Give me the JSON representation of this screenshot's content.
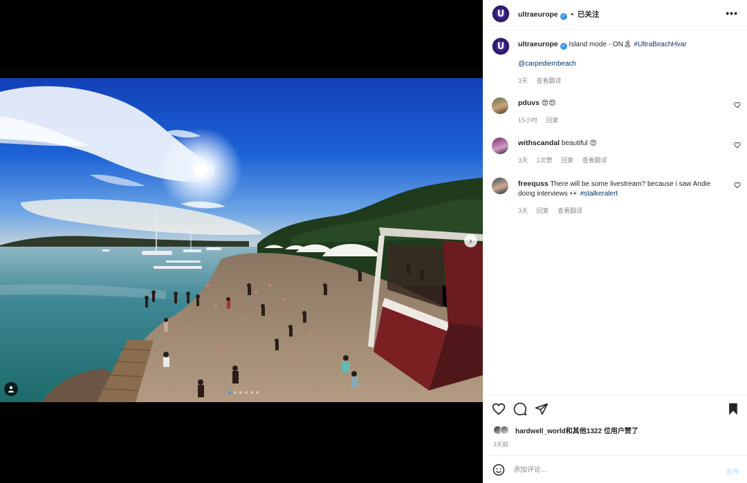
{
  "media": {
    "carousel_total": 6,
    "carousel_active": 1,
    "next_icon": "chevron-right-icon",
    "tag_icon": "person-tag-icon"
  },
  "header": {
    "username": "ultraeurope",
    "verified_icon": "verified-badge-icon",
    "separator": "•",
    "follow_status": "已关注",
    "more_icon": "more-dots-icon",
    "avatar_letter": "U"
  },
  "caption": {
    "username": "ultraeurope",
    "text": "Island mode - ON🏝",
    "hashtag": "#UltraBeachHvar",
    "mention": "@carpediembeach",
    "time": "3天",
    "translate": "查看翻译"
  },
  "comments": [
    {
      "username": "pduvs",
      "text": "😍😍",
      "time": "15小时",
      "reply": "回复",
      "likes": "",
      "translate": ""
    },
    {
      "username": "withscandal",
      "text": "beautiful 😍",
      "time": "3天",
      "likes": "1次赞",
      "reply": "回复",
      "translate": "查看翻译"
    },
    {
      "username": "freequss",
      "text": "There will be some livestream? because i saw Andie doing interviews 👀 ",
      "hashtag": "#stalkeralert",
      "time": "3天",
      "reply": "回复",
      "likes": "",
      "translate": "查看翻译"
    }
  ],
  "actions": {
    "like_icon": "heart-icon",
    "comment_icon": "comment-icon",
    "share_icon": "share-icon",
    "save_icon": "bookmark-icon",
    "likes_text": "hardwell_world和其他1322 位用户赞了",
    "posted_time": "3天前"
  },
  "add_comment": {
    "emoji_icon": "emoji-icon",
    "placeholder": "添加评论...",
    "post_label": "发布"
  },
  "colors": {
    "link": "#00376b",
    "verified": "#3897f0",
    "post_disabled": "#b3dbff",
    "secondary_text": "#8e8e8e"
  }
}
